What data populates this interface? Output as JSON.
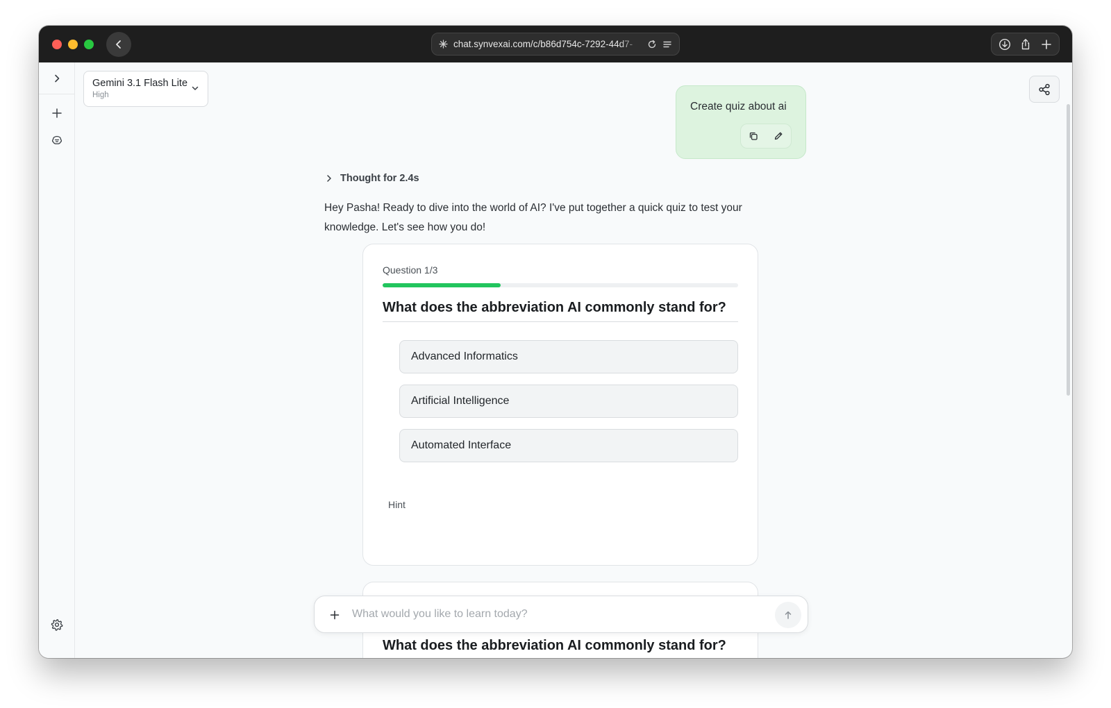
{
  "browser": {
    "url": "chat.synvexai.com/c/b86d754c-7292-44d7-",
    "icons": [
      "back-icon",
      "site-settings-icon",
      "reload-icon",
      "reader-icon",
      "download-icon",
      "share-icon",
      "new-tab-icon"
    ]
  },
  "sidebar": {
    "icons": [
      "expand-sidebar-icon",
      "new-chat-icon",
      "brain-icon",
      "settings-icon"
    ]
  },
  "model": {
    "name": "Gemini 3.1 Flash Lite",
    "level": "High"
  },
  "user_message": {
    "text": "Create quiz about ai"
  },
  "thought": {
    "label": "Thought for 2.4s"
  },
  "assistant": {
    "text": "Hey Pasha! Ready to dive into the world of AI? I've put together a quick quiz to test your knowledge. Let's see how you do!"
  },
  "quiz": {
    "counter": "Question 1/3",
    "progress": 0.333,
    "question": "What does the abbreviation AI commonly stand for?",
    "options": [
      "Advanced Informatics",
      "Artificial Intelligence",
      "Automated Interface"
    ],
    "hint_label": "Hint"
  },
  "quiz_next": {
    "question": "What does the abbreviation AI commonly stand for?"
  },
  "composer": {
    "placeholder": "What would you like to learn today?"
  },
  "colors": {
    "accent": "#22c55e",
    "user_bubble": "#ddf3df",
    "titlebar": "#1e1e1e"
  }
}
